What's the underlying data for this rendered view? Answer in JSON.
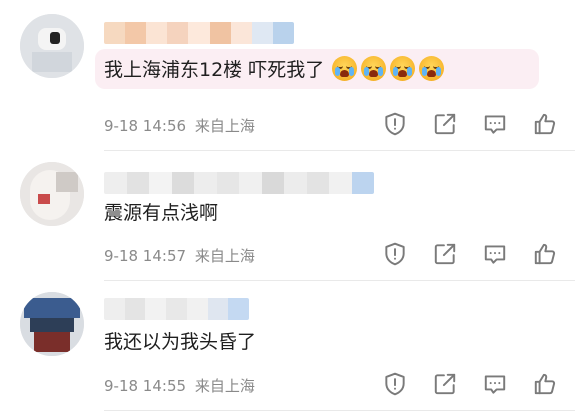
{
  "comments": [
    {
      "text": "我上海浦东12楼 吓死我了",
      "emojis": [
        "crying-face-emoji",
        "crying-face-emoji",
        "crying-face-emoji",
        "crying-face-emoji"
      ],
      "date": "9-18 14:56",
      "source": "来自上海"
    },
    {
      "text": "震源有点浅啊",
      "date": "9-18 14:57",
      "source": "来自上海"
    },
    {
      "text": "我还以为我头昏了",
      "date": "9-18 14:55",
      "source": "来自上海"
    }
  ],
  "action_icons": [
    "report-icon",
    "share-icon",
    "comment-icon",
    "like-icon"
  ],
  "colors": {
    "highlight_bg": "#fbeef3",
    "meta_text": "#8a8a8a",
    "icon_stroke": "#7a7a7a"
  }
}
